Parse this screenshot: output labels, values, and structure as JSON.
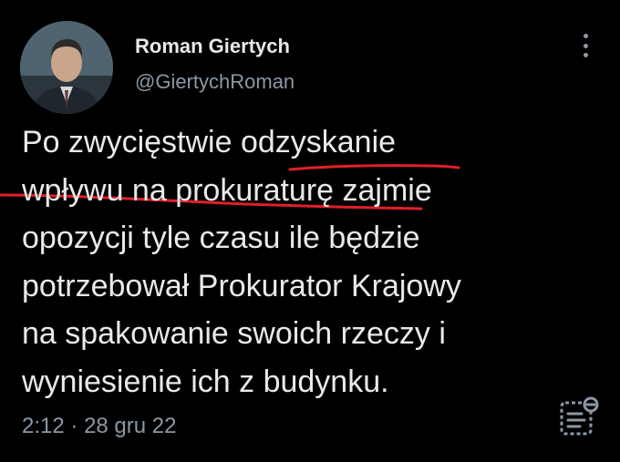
{
  "author": {
    "name": "Roman Giertych",
    "handle": "@GiertychRoman"
  },
  "tweet": {
    "lines": [
      "Po zwycięstwie odzyskanie",
      "wpływu na prokuraturę zajmie",
      "opozycji tyle czasu ile będzie",
      "potrzebował Prokurator Krajowy",
      "na spakowanie swoich rzeczy i",
      "wyniesienie ich z budynku."
    ],
    "time": "2:12",
    "separator": "·",
    "date": "28 gru 22"
  },
  "icons": {
    "more": "more-vertical-icon",
    "analytics": "tweet-analytics-icon"
  },
  "colors": {
    "background": "#000000",
    "text": "#e7e9ea",
    "secondary_text": "#8b98a5",
    "annotation": "#e0202a"
  }
}
